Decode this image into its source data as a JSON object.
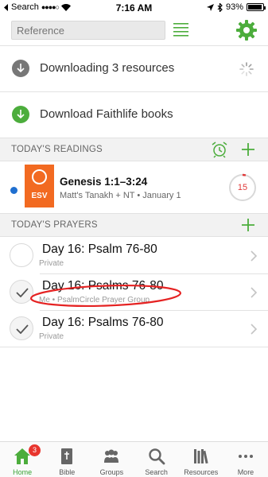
{
  "status_bar": {
    "carrier": "Search",
    "time": "7:16 AM",
    "battery_percent_label": "93%",
    "battery_level": 0.93
  },
  "header": {
    "reference_placeholder": "Reference"
  },
  "downloads": [
    {
      "label": "Downloading 3 resources",
      "icon": "download-arrow-icon",
      "icon_color": "#777777"
    },
    {
      "label": "Download Faithlife books",
      "icon": "download-arrow-icon",
      "icon_color": "#4cad3c"
    }
  ],
  "readings": {
    "header": "TODAY'S READINGS",
    "items": [
      {
        "title": "Genesis 1:1–3:24",
        "subtitle": "Matt's Tanakh + NT • January 1",
        "cover_label": "ESV",
        "cover_color": "#f26a21",
        "progress_number": "15",
        "progress_fraction": 0.04
      }
    ]
  },
  "prayers": {
    "header": "TODAY'S PRAYERS",
    "items": [
      {
        "title": "Day 16: Psalm 76-80",
        "subtitle": "Private",
        "checked": false
      },
      {
        "title": "Day 16: Psalms 76-80",
        "subtitle": "Me • PsalmCircle Prayer Group",
        "checked": true
      },
      {
        "title": "Day 16: Psalms 76-80",
        "subtitle": "Private",
        "checked": true
      }
    ]
  },
  "tab_bar": {
    "tabs": [
      {
        "label": "Home",
        "icon": "home-icon",
        "badge": "3",
        "active": true
      },
      {
        "label": "Bible",
        "icon": "bible-icon"
      },
      {
        "label": "Groups",
        "icon": "groups-icon"
      },
      {
        "label": "Search",
        "icon": "search-icon"
      },
      {
        "label": "Resources",
        "icon": "resources-icon"
      },
      {
        "label": "More",
        "icon": "more-icon"
      }
    ]
  },
  "colors": {
    "accent_green": "#4cad3c",
    "annotation_red": "#e52222",
    "unread_blue": "#1f6fd0"
  }
}
